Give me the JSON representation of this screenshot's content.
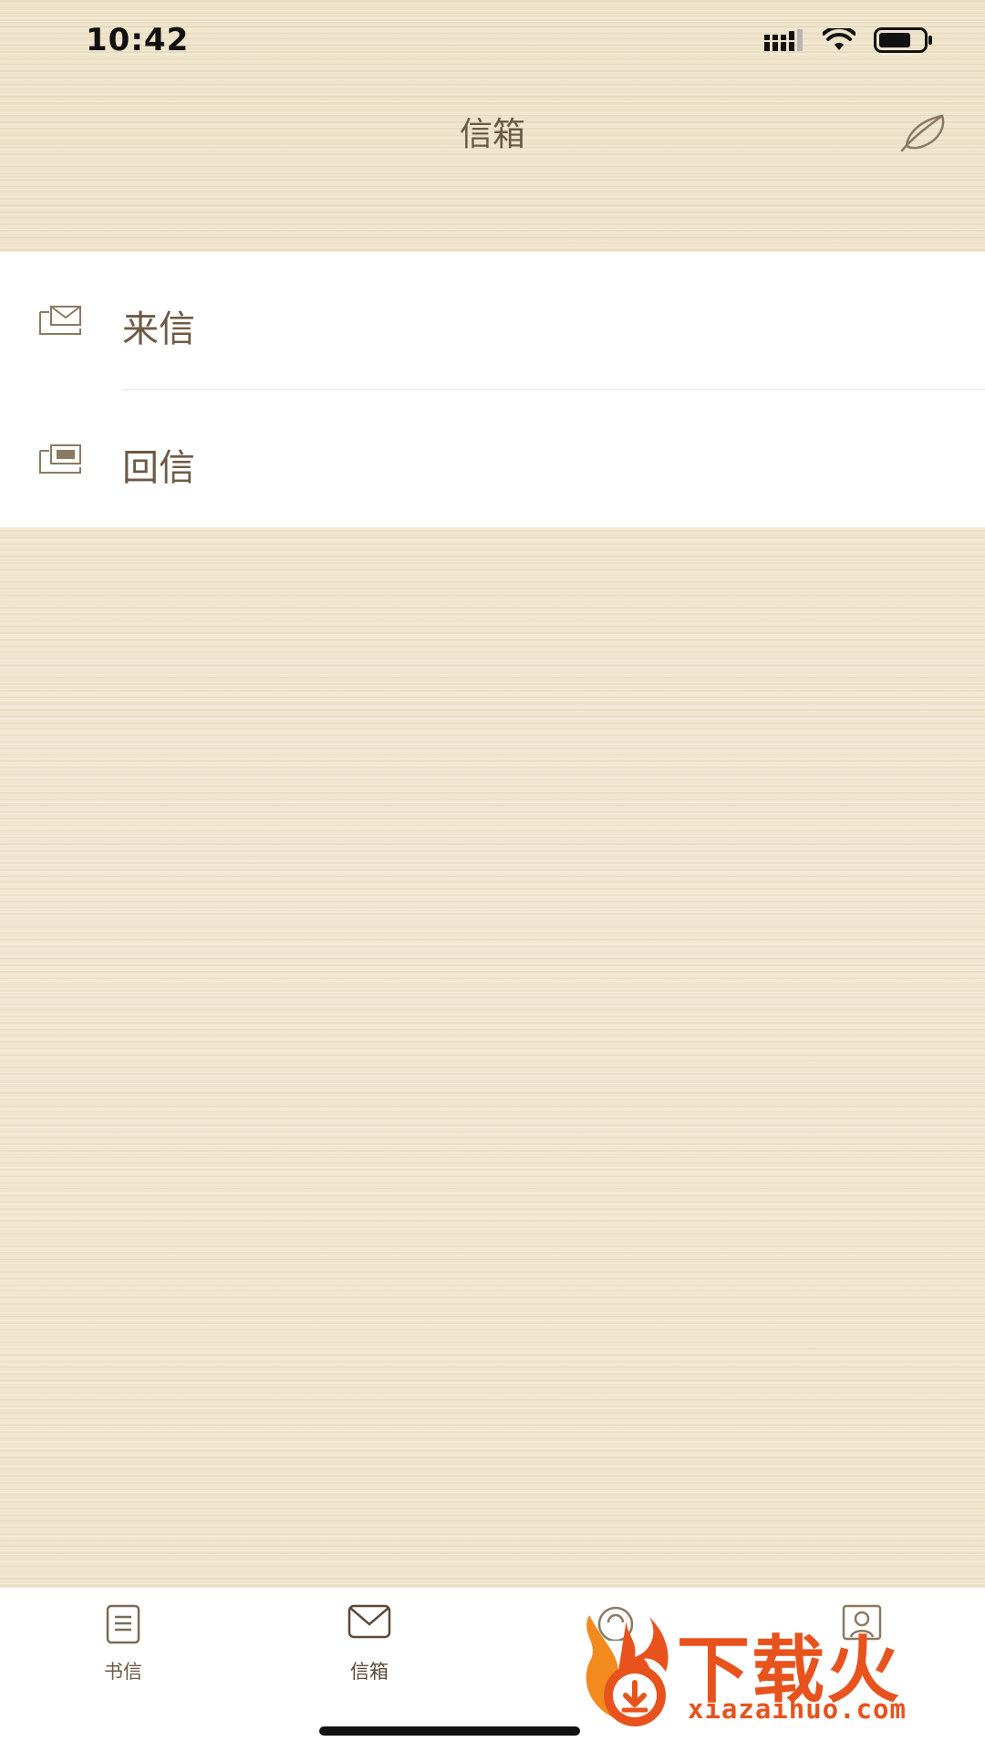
{
  "status_bar": {
    "time": "10:42"
  },
  "nav": {
    "title": "信箱",
    "compose_icon": "feather-icon"
  },
  "mailbox": {
    "items": [
      {
        "label": "来信",
        "icon": "inbox-envelope-icon"
      },
      {
        "label": "回信",
        "icon": "reply-envelope-icon"
      }
    ]
  },
  "tabs": [
    {
      "label": "书信",
      "icon": "letter-document-icon",
      "active": false
    },
    {
      "label": "信箱",
      "icon": "envelope-icon",
      "active": true
    },
    {
      "label": "",
      "icon": "discover-icon",
      "active": false
    },
    {
      "label": "",
      "icon": "profile-icon",
      "active": false
    }
  ],
  "watermark": {
    "brand": "下载火",
    "url": "xiazaihuo.com"
  },
  "colors": {
    "background": "#efe5cd",
    "text_brown": "#6d5a45",
    "watermark_orange": "#e8521c"
  }
}
